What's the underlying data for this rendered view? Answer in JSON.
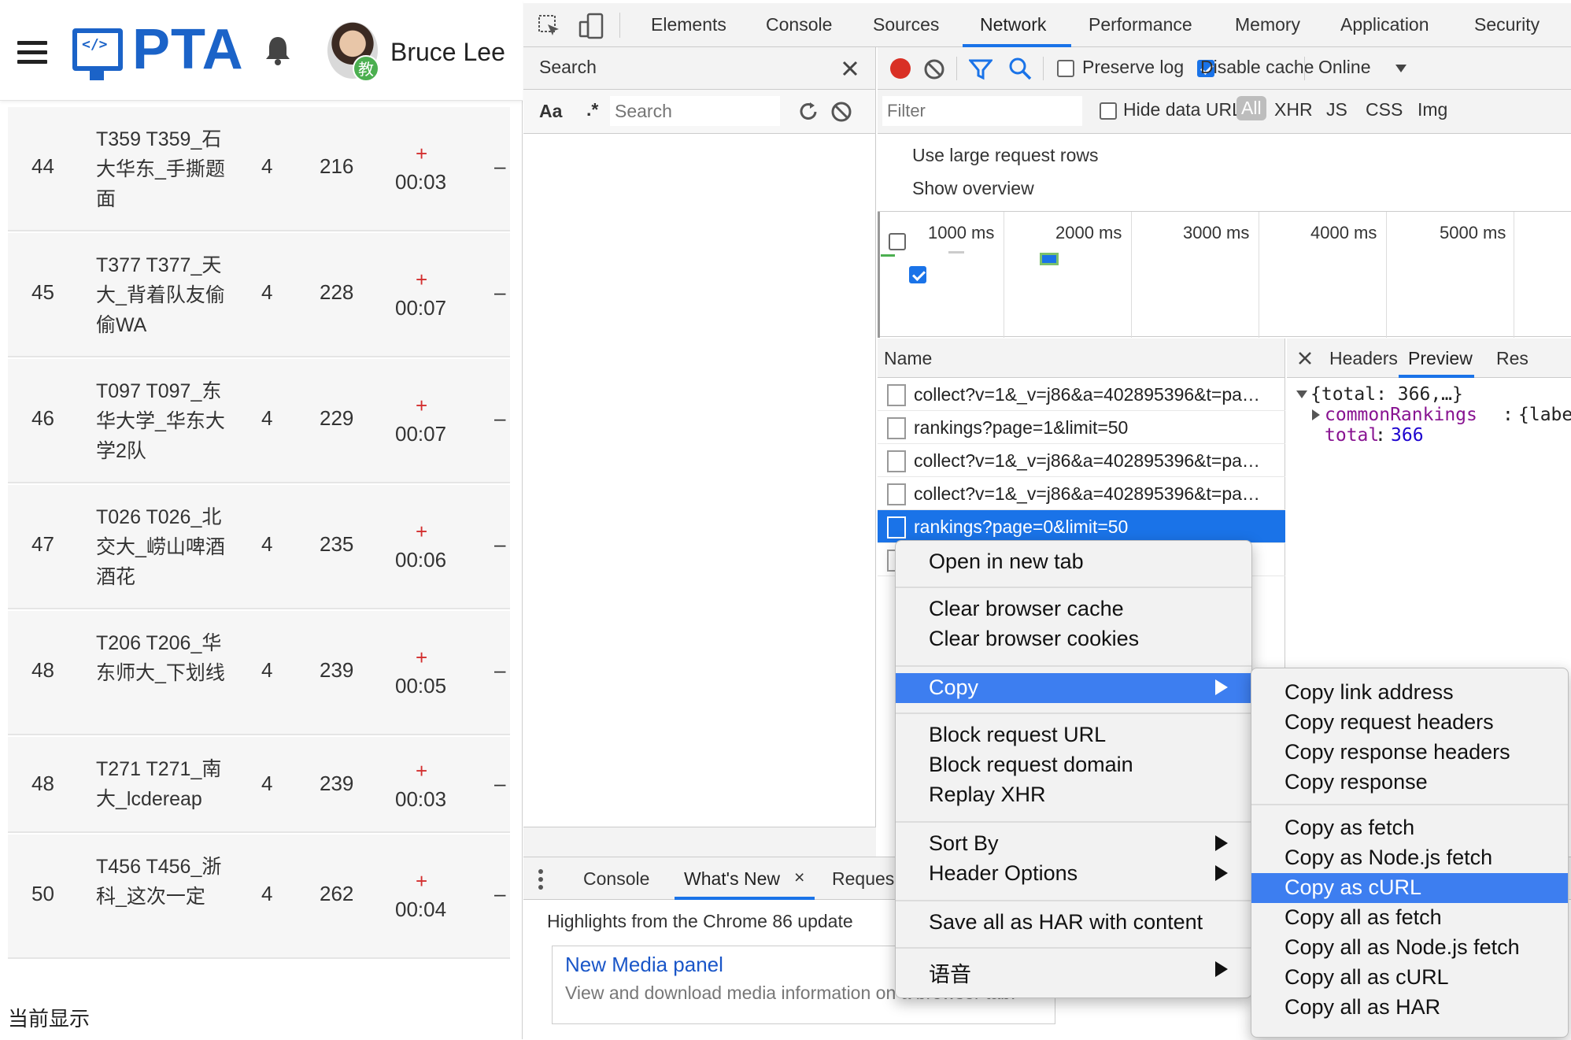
{
  "left": {
    "brand": "PTA",
    "logo_code": "</>",
    "user_name": "Bruce Lee",
    "user_badge": "教",
    "rows": [
      {
        "rank": "44",
        "team": "T359 T359_石大华东_手撕题面",
        "solved": "4",
        "penalty": "216",
        "plus": "+",
        "time": "00:03",
        "dash": "–"
      },
      {
        "rank": "45",
        "team": "T377 T377_天大_背着队友偷偷WA",
        "solved": "4",
        "penalty": "228",
        "plus": "+",
        "time": "00:07",
        "dash": "–"
      },
      {
        "rank": "46",
        "team": "T097 T097_东华大学_华东大学2队",
        "solved": "4",
        "penalty": "229",
        "plus": "+",
        "time": "00:07",
        "dash": "–"
      },
      {
        "rank": "47",
        "team": "T026 T026_北交大_崂山啤酒酒花",
        "solved": "4",
        "penalty": "235",
        "plus": "+",
        "time": "00:06",
        "dash": "–"
      },
      {
        "rank": "48",
        "team": "T206 T206_华东师大_下划线",
        "solved": "4",
        "penalty": "239",
        "plus": "+",
        "time": "00:05",
        "dash": "–"
      },
      {
        "rank": "48",
        "team": "T271 T271_南大_lcdereap",
        "solved": "4",
        "penalty": "239",
        "plus": "+",
        "time": "00:03",
        "dash": "–"
      },
      {
        "rank": "50",
        "team": "T456 T456_浙科_这次一定",
        "solved": "4",
        "penalty": "262",
        "plus": "+",
        "time": "00:04",
        "dash": "–"
      }
    ],
    "footer": "当前显示"
  },
  "devtools": {
    "tabs": [
      "Elements",
      "Console",
      "Sources",
      "Network",
      "Performance",
      "Memory",
      "Application",
      "Security"
    ],
    "active_tab": "Network",
    "search": {
      "title": "Search",
      "case_label": "Aa",
      "regex_label": ".*",
      "placeholder": "Search"
    },
    "toolbar": {
      "preserve_log": "Preserve log",
      "disable_cache": "Disable cache",
      "throttle": "Online"
    },
    "filter": {
      "placeholder": "Filter",
      "hide_data_urls": "Hide data URLs",
      "types": [
        "All",
        "XHR",
        "JS",
        "CSS",
        "Img"
      ]
    },
    "options": {
      "large_rows": "Use large request rows",
      "show_overview": "Show overview"
    },
    "timeline_labels": [
      "1000 ms",
      "2000 ms",
      "3000 ms",
      "4000 ms",
      "5000 ms"
    ],
    "list_header": "Name",
    "requests": [
      "collect?v=1&_v=j86&a=402895396&t=pa…",
      "rankings?page=1&limit=50",
      "collect?v=1&_v=j86&a=402895396&t=pa…",
      "collect?v=1&_v=j86&a=402895396&t=pa…",
      "rankings?page=0&limit=50"
    ],
    "detail_tabs": [
      "Headers",
      "Preview",
      "Res"
    ],
    "preview": {
      "root": "{total: 366,…}",
      "key1": "commonRankings",
      "val1": "{labe",
      "key2": "total",
      "val2": "366"
    },
    "drawer": {
      "tabs": [
        "Console",
        "What's New",
        "Reques"
      ],
      "highlights": "Highlights from the Chrome 86 update",
      "card_title": "New Media panel",
      "card_text": "View and download media information on a browser tab."
    }
  },
  "context_menu": {
    "items": [
      "Open in new tab",
      "Clear browser cache",
      "Clear browser cookies",
      "Copy",
      "Block request URL",
      "Block request domain",
      "Replay XHR",
      "Sort By",
      "Header Options",
      "Save all as HAR with content",
      "语音"
    ]
  },
  "copy_submenu": {
    "items": [
      "Copy link address",
      "Copy request headers",
      "Copy response headers",
      "Copy response",
      "Copy as fetch",
      "Copy as Node.js fetch",
      "Copy as cURL",
      "Copy all as fetch",
      "Copy all as Node.js fetch",
      "Copy all as cURL",
      "Copy all as HAR"
    ]
  },
  "colors": {
    "accent": "#1a73e8",
    "brand": "#1b63c8",
    "menu_highlight": "#3d7ef0",
    "record": "#d93025"
  }
}
